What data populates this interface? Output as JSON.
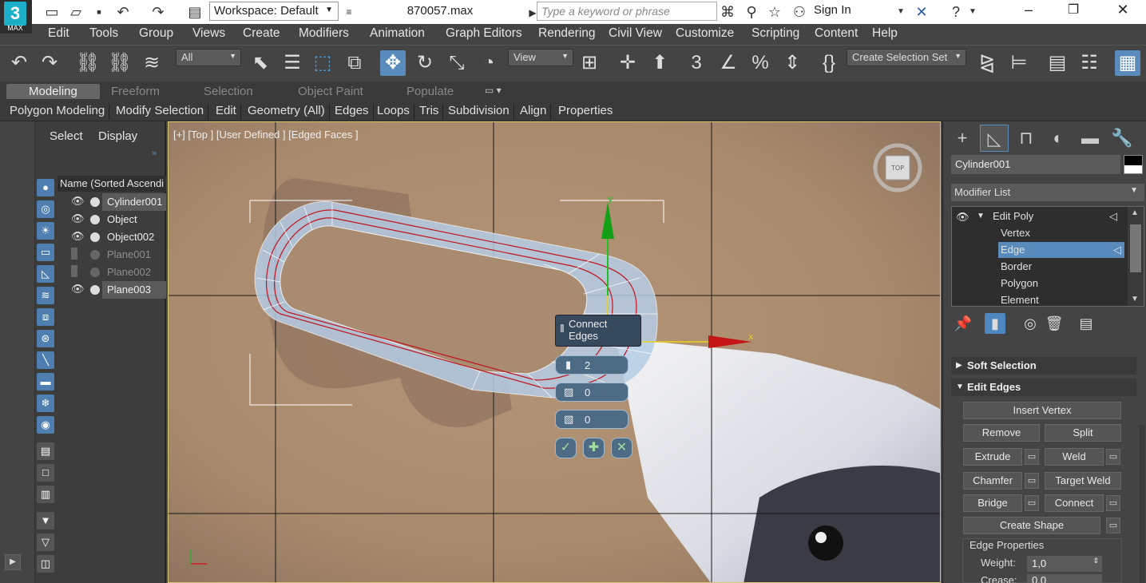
{
  "app": {
    "logo_main": "3",
    "logo_sub": "MAX",
    "workspace": "Workspace: Default",
    "filename": "870057.max",
    "search_placeholder": "Type a keyword or phrase",
    "signin": "Sign In"
  },
  "menu": [
    "Edit",
    "Tools",
    "Group",
    "Views",
    "Create",
    "Modifiers",
    "Animation",
    "Graph Editors",
    "Rendering",
    "Civil View",
    "Customize",
    "Scripting",
    "Content",
    "Help"
  ],
  "toolbar": {
    "selection_filter": "All",
    "ref_coord": "View",
    "named_selection": "Create Selection Set"
  },
  "ribbon": {
    "tabs": [
      "Modeling",
      "Freeform",
      "Selection",
      "Object Paint",
      "Populate"
    ],
    "subtabs": [
      "Polygon Modeling",
      "Modify Selection",
      "Edit",
      "Geometry (All)",
      "Edges",
      "Loops",
      "Tris",
      "Subdivision",
      "Align",
      "Properties"
    ]
  },
  "scene_explorer": {
    "tabs": [
      "Select",
      "Display"
    ],
    "column_header": "Name (Sorted Ascendi",
    "items": [
      {
        "name": "Cylinder001",
        "visible": true,
        "selected": true
      },
      {
        "name": "Object",
        "visible": true,
        "selected": false
      },
      {
        "name": "Object002",
        "visible": true,
        "selected": false
      },
      {
        "name": "Plane001",
        "visible": false,
        "selected": false
      },
      {
        "name": "Plane002",
        "visible": false,
        "selected": false
      },
      {
        "name": "Plane003",
        "visible": true,
        "selected": true
      }
    ]
  },
  "viewport": {
    "label": "[+] [Top ] [User Defined ] [Edged Faces ]",
    "viewcube_label": "TOP",
    "axis_y": "y",
    "axis_x": "x",
    "caddy": {
      "title": "Connect Edges",
      "segments": "2",
      "pinch": "0",
      "slide": "0"
    }
  },
  "command_panel": {
    "object_name": "Cylinder001",
    "modifier_list": "Modifier List",
    "stack": [
      "Edit Poly",
      "Vertex",
      "Edge",
      "Border",
      "Polygon",
      "Element"
    ],
    "rollouts": {
      "soft_selection": "Soft Selection",
      "edit_edges": "Edit Edges"
    },
    "buttons": {
      "insert_vertex": "Insert Vertex",
      "remove": "Remove",
      "split": "Split",
      "extrude": "Extrude",
      "weld": "Weld",
      "chamfer": "Chamfer",
      "target_weld": "Target Weld",
      "bridge": "Bridge",
      "connect": "Connect",
      "create_shape": "Create Shape"
    },
    "edge_properties": {
      "title": "Edge Properties",
      "weight_label": "Weight:",
      "weight_value": "1,0",
      "crease_label": "Crease:",
      "crease_value": "0,0"
    }
  }
}
